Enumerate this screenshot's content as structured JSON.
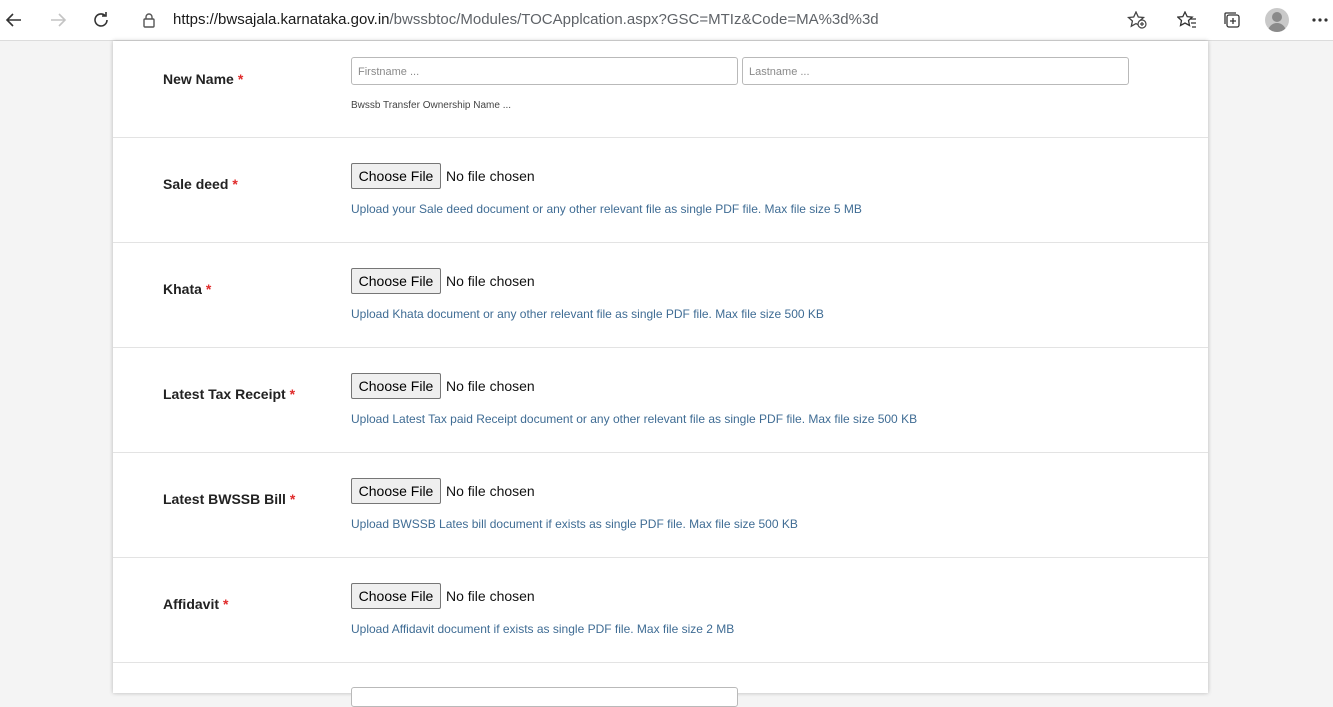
{
  "browser": {
    "url_host": "https://bwsajala.karnataka.gov.in",
    "url_path": "/bwssbtoc/Modules/TOCApplcation.aspx?GSC=MTIz&Code=MA%3d%3d",
    "icons": [
      "back-icon",
      "forward-icon",
      "refresh-icon",
      "lock-icon",
      "add-favorite-icon",
      "favorites-icon",
      "collections-icon",
      "profile-avatar",
      "more-icon"
    ]
  },
  "form": {
    "new_name": {
      "label": "New Name",
      "required_mark": "*",
      "firstname_placeholder": "Firstname ...",
      "lastname_placeholder": "Lastname ...",
      "help": "Bwssb Transfer Ownership Name ..."
    },
    "uploads": [
      {
        "label": "Sale deed",
        "required_mark": "*",
        "button": "Choose File",
        "status": "No file chosen",
        "help": "Upload your Sale deed document or any other relevant file as single PDF file. Max file size 5 MB"
      },
      {
        "label": "Khata",
        "required_mark": "*",
        "button": "Choose File",
        "status": "No file chosen",
        "help": "Upload Khata document or any other relevant file as single PDF file. Max file size 500 KB"
      },
      {
        "label": "Latest Tax Receipt",
        "required_mark": "*",
        "button": "Choose File",
        "status": "No file chosen",
        "help": "Upload Latest Tax paid Receipt document or any other relevant file as single PDF file. Max file size 500 KB"
      },
      {
        "label": "Latest BWSSB Bill",
        "required_mark": "*",
        "button": "Choose File",
        "status": "No file chosen",
        "help": "Upload BWSSB Lates bill document if exists as single PDF file. Max file size 500 KB"
      },
      {
        "label": "Affidavit",
        "required_mark": "*",
        "button": "Choose File",
        "status": "No file chosen",
        "help": "Upload Affidavit document if exists as single PDF file. Max file size 2 MB"
      }
    ]
  },
  "colors": {
    "required": "#e02b2b",
    "help_text": "#3f6c94",
    "page_bg": "#f4f4f4"
  }
}
